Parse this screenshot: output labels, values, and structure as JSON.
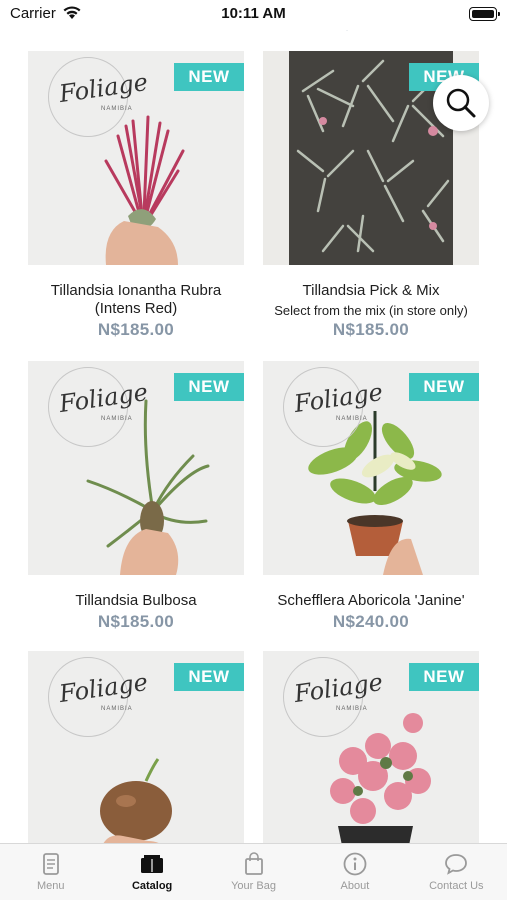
{
  "status_bar": {
    "carrier": "Carrier",
    "time": "10:11 AM"
  },
  "prev_row_price": "N$240.00",
  "products": [
    {
      "name": "Tillandsia Ionantha Rubra (Intens Red)",
      "subtitle": "",
      "price": "N$185.00",
      "badge": "NEW",
      "logo": "Foliage",
      "logo_sub": "NAMIBIA"
    },
    {
      "name": "Tillandsia Pick & Mix",
      "subtitle": "Select from the mix (in store only)",
      "price": "N$185.00",
      "badge": "NEW"
    },
    {
      "name": "Tillandsia Bulbosa",
      "subtitle": "",
      "price": "N$185.00",
      "badge": "NEW",
      "logo": "Foliage",
      "logo_sub": "NAMIBIA"
    },
    {
      "name": "Schefflera Aboricola 'Janine'",
      "subtitle": "",
      "price": "N$240.00",
      "badge": "NEW",
      "logo": "Foliage",
      "logo_sub": "NAMIBIA"
    },
    {
      "name": "",
      "subtitle": "",
      "price": "",
      "badge": "NEW",
      "logo": "Foliage",
      "logo_sub": "NAMIBIA"
    },
    {
      "name": "",
      "subtitle": "",
      "price": "",
      "badge": "NEW",
      "logo": "Foliage",
      "logo_sub": "NAMIBIA"
    }
  ],
  "tabs": [
    {
      "label": "Menu",
      "icon": "menu-icon",
      "active": false
    },
    {
      "label": "Catalog",
      "icon": "catalog-icon",
      "active": true
    },
    {
      "label": "Your Bag",
      "icon": "bag-icon",
      "active": false
    },
    {
      "label": "About",
      "icon": "info-icon",
      "active": false
    },
    {
      "label": "Contact Us",
      "icon": "chat-icon",
      "active": false
    }
  ],
  "colors": {
    "badge": "#3fc5c0",
    "price": "#8796a6",
    "tab_inactive": "#9a9a9a",
    "tab_active": "#111111"
  }
}
